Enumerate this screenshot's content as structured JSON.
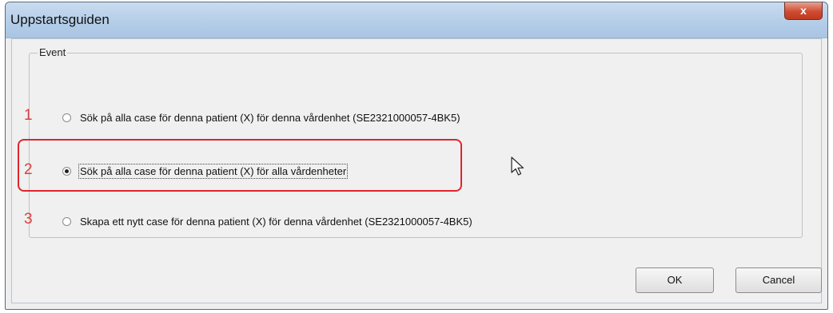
{
  "window": {
    "title": "Uppstartsguiden",
    "close_glyph": "x"
  },
  "group": {
    "legend": "Event"
  },
  "options": [
    {
      "marker": "1",
      "label": "Sök på alla case för denna patient (X) för denna vårdenhet (SE2321000057-4BK5)",
      "checked": false
    },
    {
      "marker": "2",
      "label": "Sök på alla case för denna patient (X) för alla vårdenheter",
      "checked": true
    },
    {
      "marker": "3",
      "label": "Skapa ett nytt case för denna patient (X) för denna vårdenhet (SE2321000057-4BK5)",
      "checked": false
    }
  ],
  "buttons": {
    "ok": "OK",
    "cancel": "Cancel"
  },
  "colors": {
    "annotation": "#e0252b",
    "marker": "#d94040"
  },
  "icons": {
    "close": "close-icon",
    "cursor": "mouse-pointer-icon"
  }
}
